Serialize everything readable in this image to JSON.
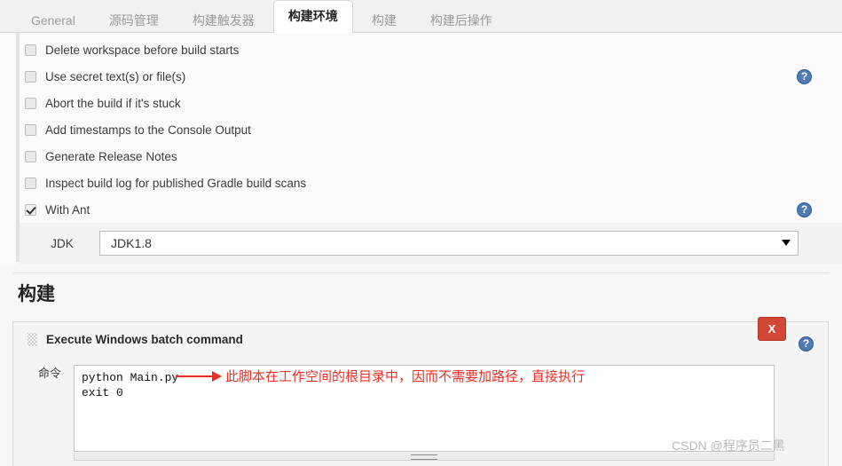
{
  "tabs": [
    {
      "label": "General",
      "active": false
    },
    {
      "label": "源码管理",
      "active": false
    },
    {
      "label": "构建触发器",
      "active": false
    },
    {
      "label": "构建环境",
      "active": true
    },
    {
      "label": "构建",
      "active": false
    },
    {
      "label": "构建后操作",
      "active": false
    }
  ],
  "build_environment": {
    "options": [
      {
        "label": "Delete workspace before build starts",
        "checked": false,
        "help": false
      },
      {
        "label": "Use secret text(s) or file(s)",
        "checked": false,
        "help": true
      },
      {
        "label": "Abort the build if it's stuck",
        "checked": false,
        "help": false
      },
      {
        "label": "Add timestamps to the Console Output",
        "checked": false,
        "help": false
      },
      {
        "label": "Generate Release Notes",
        "checked": false,
        "help": false
      },
      {
        "label": "Inspect build log for published Gradle build scans",
        "checked": false,
        "help": false
      },
      {
        "label": "With Ant",
        "checked": true,
        "help": true
      }
    ],
    "jdk": {
      "label": "JDK",
      "selected": "JDK1.8",
      "options": [
        "JDK1.8"
      ]
    }
  },
  "build_section": {
    "title": "构建",
    "step": {
      "title": "Execute Windows batch command",
      "delete_label": "X",
      "help_label": "?",
      "command_label": "命令",
      "command_value": "python Main.py\nexit 0"
    },
    "annotation": "此脚本在工作空间的根目录中，因而不需要加路径，直接执行"
  },
  "icons": {
    "help": "?",
    "grip": "drag-handle-icon",
    "dropdown_arrow": "chevron-down-icon"
  },
  "watermark": "CSDN @程序员二黑",
  "colors": {
    "accent_blue": "#4f7bb5",
    "danger_red": "#d14836",
    "annotation_red": "#ee2d24",
    "page_bg": "#fafafa"
  }
}
